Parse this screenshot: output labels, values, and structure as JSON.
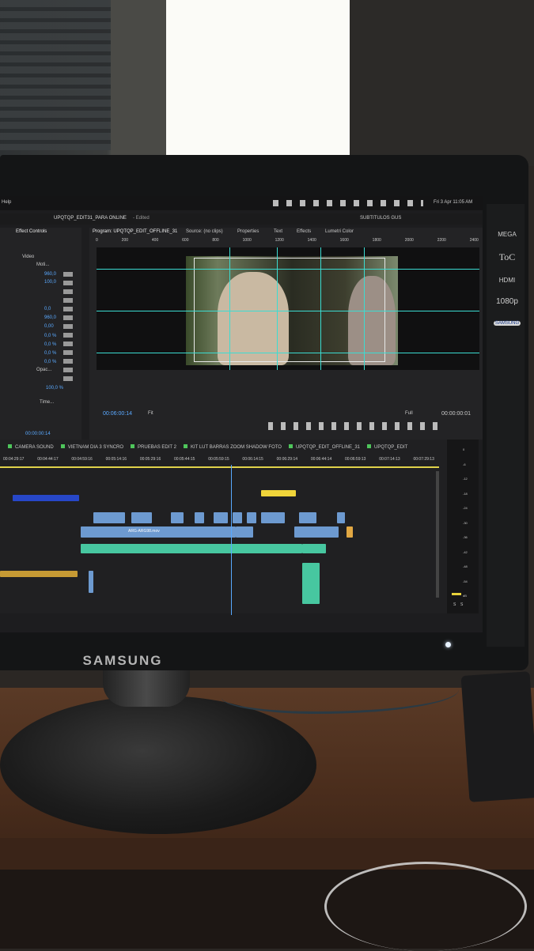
{
  "room": {
    "colors": {
      "desk": "#4a2d1c",
      "window": "#f4f3ef"
    }
  },
  "monitor": {
    "brand": "SAMSUNG",
    "badges": [
      "MEGA",
      "ToC",
      "HDMI",
      "1080p",
      "SAMSUNG"
    ]
  },
  "app": {
    "menu_left": "Help",
    "clock": "Fri 3 Apr  11:05 AM",
    "project_title": "UPQTQP_EDIT31_PARA ONLINE",
    "project_status": "- Edited",
    "top_right_label": "SUBTITULOS GUS",
    "effect_controls": {
      "panel_label": "Effect Controls",
      "section": "Video",
      "motion": "Moti...",
      "values": [
        "960,0",
        "100,0",
        "0,0",
        "960,0",
        "0,00",
        "0,0 %",
        "0,0 %",
        "0,0 %",
        "0,0 %"
      ],
      "opacity_label": "Opac...",
      "opacity_value": "100,0 %",
      "time_label": "Time...",
      "timecode": "00:00:00:14"
    },
    "program": {
      "tabs": [
        "Program: UPQTQP_EDIT_OFFLINE_31",
        "Source: (no clips)",
        "Properties",
        "Text",
        "Effects",
        "Lumetri Color"
      ],
      "timecode_left": "00:06:00:14",
      "fit": "Fit",
      "quality": "Full",
      "timecode_right": "00:00:00:01",
      "ruler": [
        "0",
        "200",
        "400",
        "600",
        "800",
        "1000",
        "1200",
        "1400",
        "1600",
        "1800",
        "2000",
        "2200",
        "2400"
      ]
    },
    "timeline": {
      "sequence_tabs": [
        "CAMERA SOUND",
        "VIETNAM DIA 3 SYNCRO",
        "PRUEBAS EDIT 2",
        "KIT LUT BARRAS ZOOM SHADOW FOTO",
        "UPQTQP_EDIT_OFFLINE_31",
        "UPQTQP_EDIT"
      ],
      "ruler": [
        "00:04:29:17",
        "00:04:44:17",
        "00:04:59:16",
        "00:05:14:16",
        "00:05:29:16",
        "00:05:44:15",
        "00:05:59:15",
        "00:06:14:15",
        "00:06:29:14",
        "00:06:44:14",
        "00:06:59:13",
        "00:07:14:13",
        "00:07:29:13"
      ],
      "clip_label": "ARG-ARG98.mov",
      "meter_scale": [
        "0",
        "-6",
        "-12",
        "-18",
        "-24",
        "-30",
        "-36",
        "-42",
        "-48",
        "-54",
        "dB"
      ],
      "meter_bottom": [
        "S",
        "S"
      ]
    }
  }
}
